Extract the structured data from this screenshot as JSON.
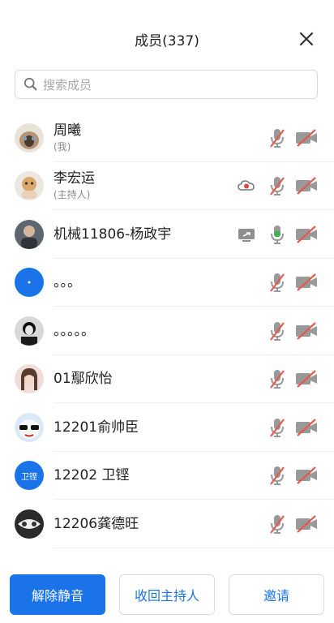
{
  "header": {
    "title": "成员(337)"
  },
  "search": {
    "placeholder": "搜索成员"
  },
  "members": [
    {
      "name": "周曦",
      "sub": "(我)",
      "avatar": "cat-photo",
      "mic": "muted",
      "cam": "off"
    },
    {
      "name": "李宏运",
      "sub": "(主持人)",
      "avatar": "doll-photo",
      "mic": "muted",
      "cam": "off",
      "extra": "cloud-record-icon"
    },
    {
      "name": "机械11806-杨政宇",
      "sub": "",
      "avatar": "person-photo",
      "mic": "active",
      "cam": "off",
      "extra": "screen-share-icon"
    },
    {
      "name": "。。。",
      "sub": "",
      "avatar": "blue-dot",
      "mic": "muted",
      "cam": "off"
    },
    {
      "name": "。。。。。",
      "sub": "",
      "avatar": "bw-photo",
      "mic": "muted",
      "cam": "off"
    },
    {
      "name": "01鄢欣怡",
      "sub": "",
      "avatar": "girl-photo",
      "mic": "muted",
      "cam": "off"
    },
    {
      "name": "12201俞帅臣",
      "sub": "",
      "avatar": "cartoon-photo",
      "mic": "muted",
      "cam": "off"
    },
    {
      "name": "12202 卫铿",
      "sub": "",
      "avatar": "text-avatar",
      "avatar_text": "卫铿",
      "mic": "muted",
      "cam": "off"
    },
    {
      "name": "12206龚德旺",
      "sub": "",
      "avatar": "eyes-photo",
      "mic": "muted",
      "cam": "off"
    }
  ],
  "footer": {
    "unmute_all": "解除静音",
    "reclaim_host": "收回主持人",
    "invite": "邀请"
  },
  "colors": {
    "accent": "#1a73e8",
    "muted_red": "#e55a4e",
    "mic_green": "#3fb24f"
  }
}
